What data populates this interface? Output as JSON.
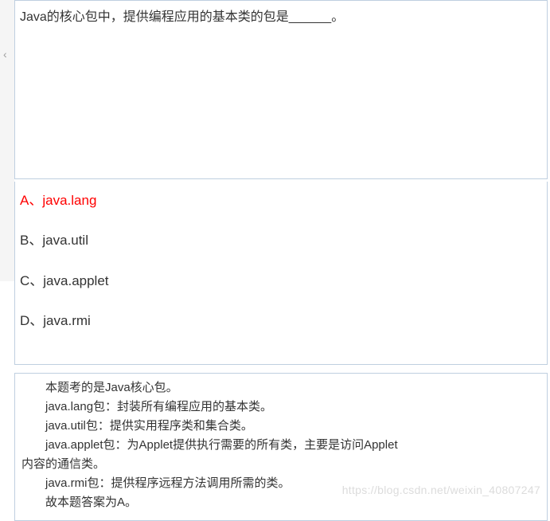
{
  "question": {
    "text": "Java的核心包中，提供编程应用的基本类的包是______。"
  },
  "options": [
    {
      "label": "A、",
      "text": "java.lang",
      "correct": true
    },
    {
      "label": "B、",
      "text": "java.util",
      "correct": false
    },
    {
      "label": "C、",
      "text": "java.applet",
      "correct": false
    },
    {
      "label": "D、",
      "text": "java.rmi",
      "correct": false
    }
  ],
  "explanation": {
    "lines": [
      "本题考的是Java核心包。",
      "java.lang包：封装所有编程应用的基本类。",
      "java.util包：提供实用程序类和集合类。",
      "java.applet包：为Applet提供执行需要的所有类，主要是访问Applet",
      "内容的通信类。",
      "java.rmi包：提供程序远程方法调用所需的类。",
      "故本题答案为A。"
    ]
  },
  "watermark": "https://blog.csdn.net/weixin_40807247",
  "caret": "‹"
}
